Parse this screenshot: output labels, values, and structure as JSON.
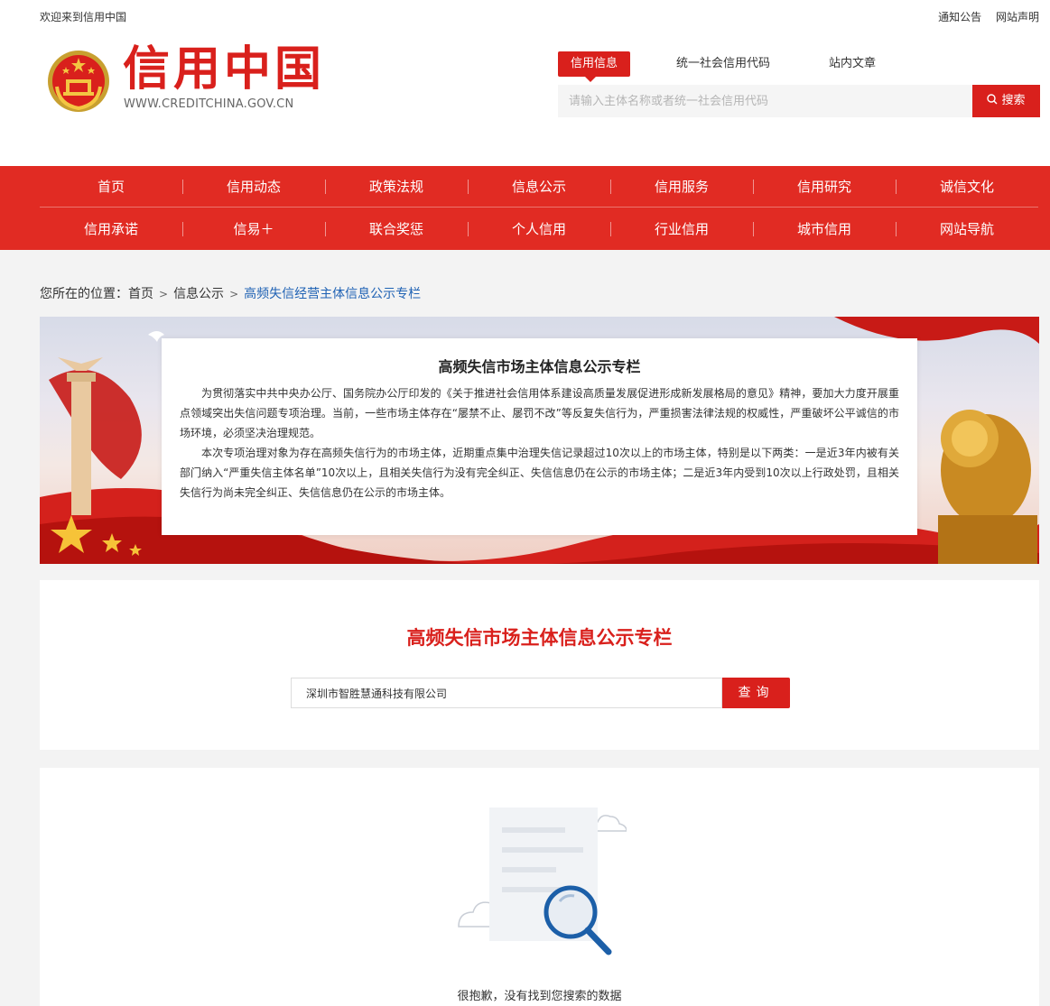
{
  "topbar": {
    "welcome": "欢迎来到信用中国",
    "links": [
      "通知公告",
      "网站声明"
    ]
  },
  "logo": {
    "title": "信用中国",
    "url_text": "WWW.CREDITCHINA.GOV.CN"
  },
  "search": {
    "tabs": [
      "信用信息",
      "统一社会信用代码",
      "站内文章"
    ],
    "active_tab": "信用信息",
    "placeholder": "请输入主体名称或者统一社会信用代码",
    "button": "搜索"
  },
  "nav": {
    "row1": [
      "首页",
      "信用动态",
      "政策法规",
      "信息公示",
      "信用服务",
      "信用研究",
      "诚信文化"
    ],
    "row2": [
      "信用承诺",
      "信易＋",
      "联合奖惩",
      "个人信用",
      "行业信用",
      "城市信用",
      "网站导航"
    ]
  },
  "breadcrumb": {
    "prefix": "您所在的位置：",
    "items": [
      "首页",
      "信息公示"
    ],
    "current": "高频失信经营主体信息公示专栏",
    "separator": ">"
  },
  "notice": {
    "title": "高频失信市场主体信息公示专栏",
    "p1": "为贯彻落实中共中央办公厅、国务院办公厅印发的《关于推进社会信用体系建设高质量发展促进形成新发展格局的意见》精神，要加大力度开展重点领域突出失信问题专项治理。当前，一些市场主体存在“屡禁不止、屡罚不改”等反复失信行为，严重损害法律法规的权威性，严重破坏公平诚信的市场环境，必须坚决治理规范。",
    "p2": "本次专项治理对象为存在高频失信行为的市场主体，近期重点集中治理失信记录超过10次以上的市场主体，特别是以下两类：一是近3年内被有关部门纳入“严重失信主体名单”10次以上，且相关失信行为没有完全纠正、失信信息仍在公示的市场主体；二是近3年内受到10次以上行政处罚，且相关失信行为尚未完全纠正、失信信息仍在公示的市场主体。"
  },
  "query": {
    "title": "高频失信市场主体信息公示专栏",
    "value": "深圳市智胜慧通科技有限公司",
    "button": "查询"
  },
  "result": {
    "empty_text": "很抱歉，没有找到您搜索的数据"
  },
  "colors": {
    "brand_red": "#d9201c",
    "nav_red": "#e12b23",
    "link_blue": "#1f62b4",
    "empty_blue": "#1c5fa8"
  }
}
